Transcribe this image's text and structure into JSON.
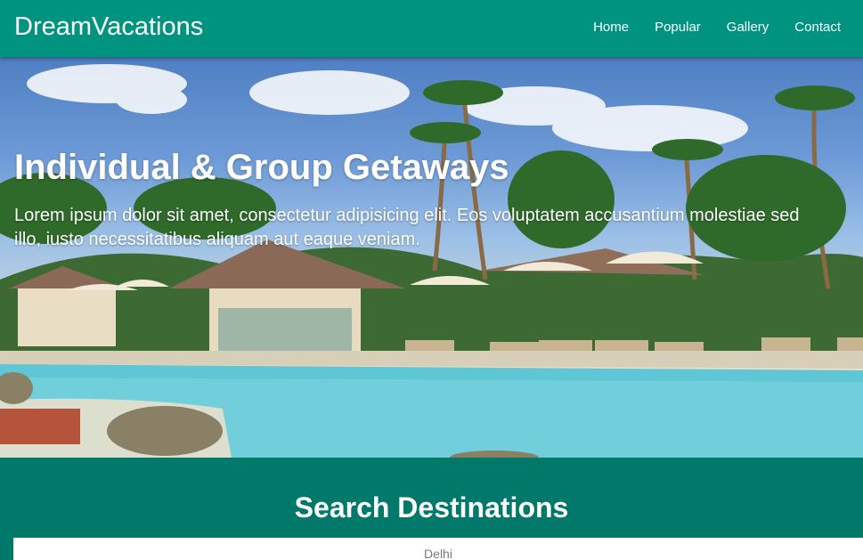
{
  "navbar": {
    "brand": "DreamVacations",
    "links": [
      "Home",
      "Popular",
      "Gallery",
      "Contact"
    ]
  },
  "hero": {
    "title": "Individual & Group Getaways",
    "text": "Lorem ipsum dolor sit amet, consectetur adipisicing elit. Eos voluptatem accusantium molestiae sed illo, iusto necessitatibus aliquam aut eaque veniam."
  },
  "search": {
    "heading": "Search Destinations",
    "value": "Delhi"
  },
  "colors": {
    "navbar": "#009480",
    "section": "#00796b"
  }
}
